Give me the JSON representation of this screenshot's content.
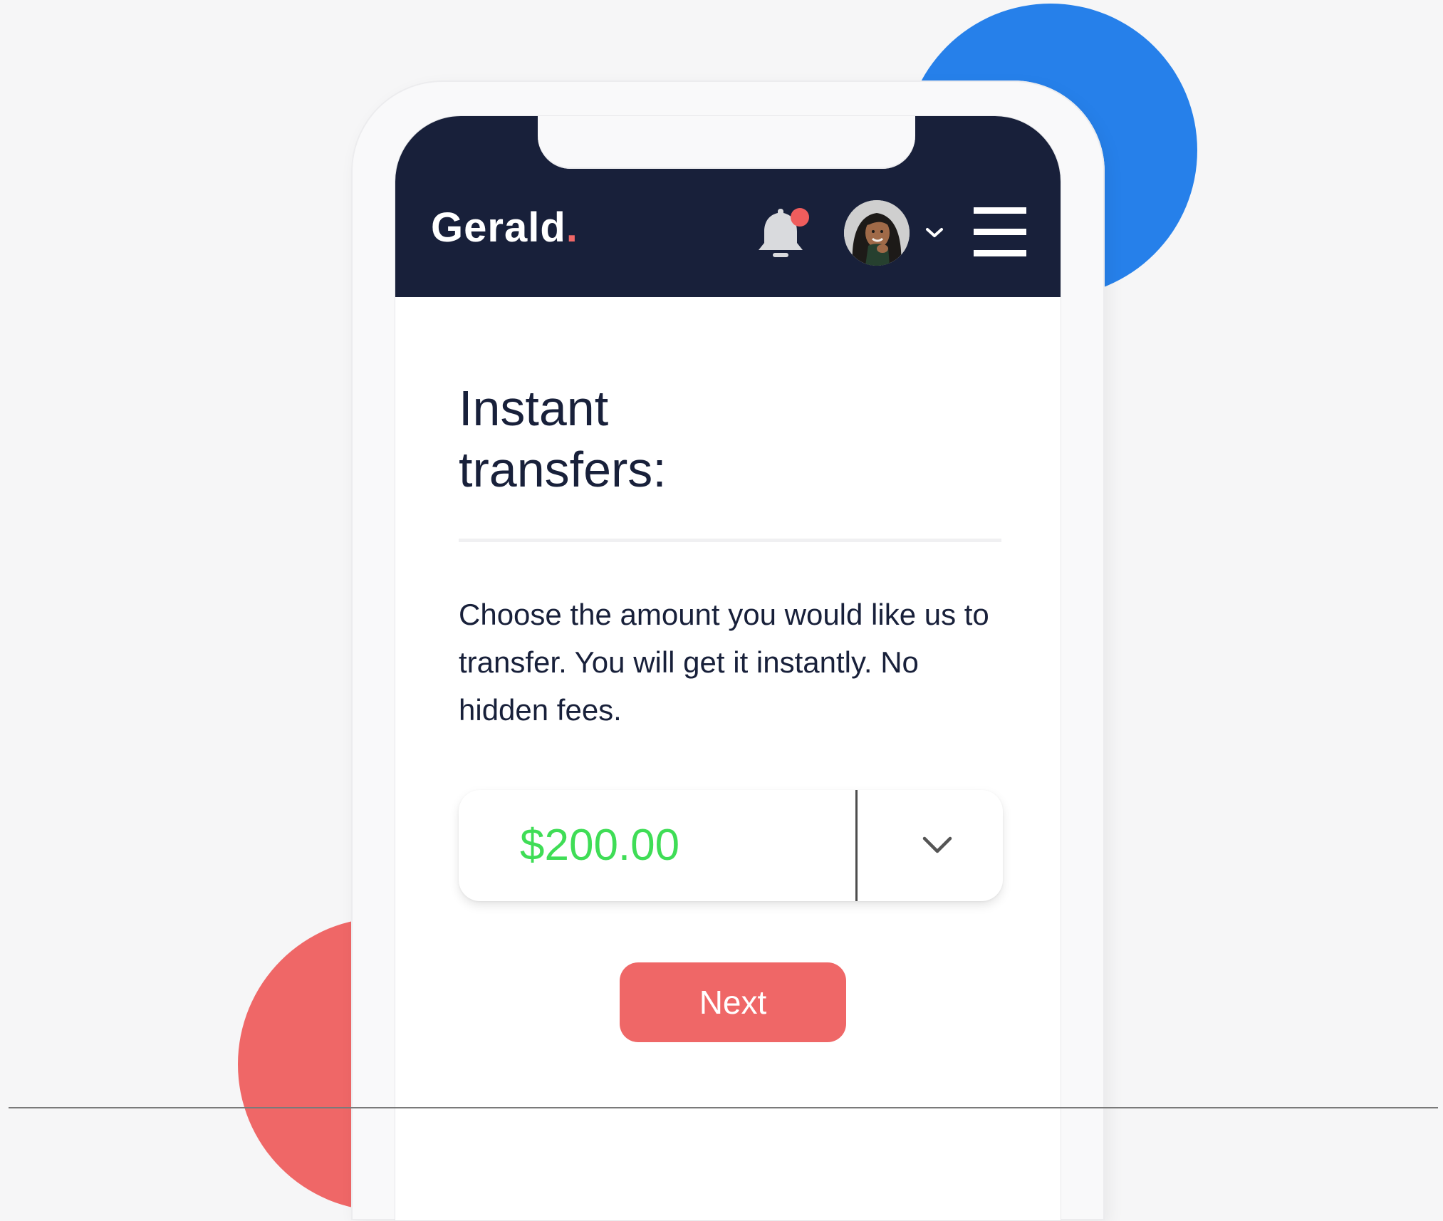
{
  "header": {
    "logo_text": "Gerald",
    "logo_dot": ".",
    "bell_icon": "bell-icon",
    "avatar_icon": "user-avatar",
    "chevron_icon": "chevron-down-icon",
    "menu_icon": "hamburger-menu-icon"
  },
  "main": {
    "title_line1": "Instant",
    "title_line2": "transfers:",
    "description": "Choose the amount you would like us to transfer. You will get it instantly. No hidden fees.",
    "amount_value": "$200.00",
    "next_label": "Next"
  },
  "colors": {
    "header_bg": "#18203a",
    "accent_red": "#ef6767",
    "accent_blue": "#2680ea",
    "amount_green": "#3fdd56",
    "notification_dot": "#ef5d5d"
  }
}
